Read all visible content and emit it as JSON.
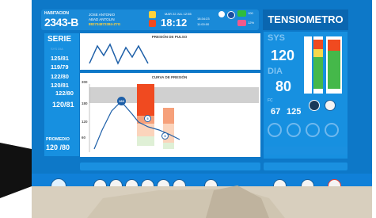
{
  "header": {
    "habitacion_label": "HABITACION",
    "habitacion_value": "2343-B",
    "patient_name": "JOSE ANTONIO",
    "patient_surname": "ABAD ANTOLIN",
    "patient_code": "882734872384-Z7G",
    "date": "MAR 22 JUL",
    "date_extra": "12:55",
    "time": "18:12",
    "time_small_1": "18:34:23",
    "time_small_2": "11:00:00",
    "battery_label": "100",
    "badge_label": "12%"
  },
  "title": "TENSIOMETRO",
  "serie": {
    "title": "SERIE",
    "header": "SYS    DIA",
    "items": [
      "125/81",
      "119/79",
      "122/80",
      "120/81",
      "122/80",
      "120/81"
    ],
    "promedio_label": "PROMEDIO",
    "promedio_value": "120 /80"
  },
  "pulse_panel": {
    "title": "PRESIÓN DE PULSO"
  },
  "curve_panel": {
    "title": "CURVA DE PRESIÓN",
    "y_ticks": [
      "300",
      "180",
      "120",
      "60"
    ],
    "markers": [
      "160",
      "5",
      "9"
    ]
  },
  "measurements": {
    "sys_label": "SYS",
    "sys_value": "120",
    "dia_label": "DIA",
    "dia_value": "80",
    "fc_label": "FC",
    "fc_value_1": "67",
    "fc_value_2": "125"
  },
  "toolbar": {
    "left_icons": [
      "cloud-icon",
      "gallery-icon",
      "image-icon",
      "check-icon",
      "pen-icon",
      "blank-icon",
      "person-icon",
      "power-icon"
    ],
    "right_icons": [
      "play-icon",
      "stop-icon",
      "record-icon"
    ]
  },
  "colors": {
    "frame": "#0d78c8",
    "panel": "#1790e0",
    "highlight": "#ffd23a",
    "alert_red": "#f04a20",
    "record": "#e83c2e",
    "play": "#3aa55a"
  }
}
